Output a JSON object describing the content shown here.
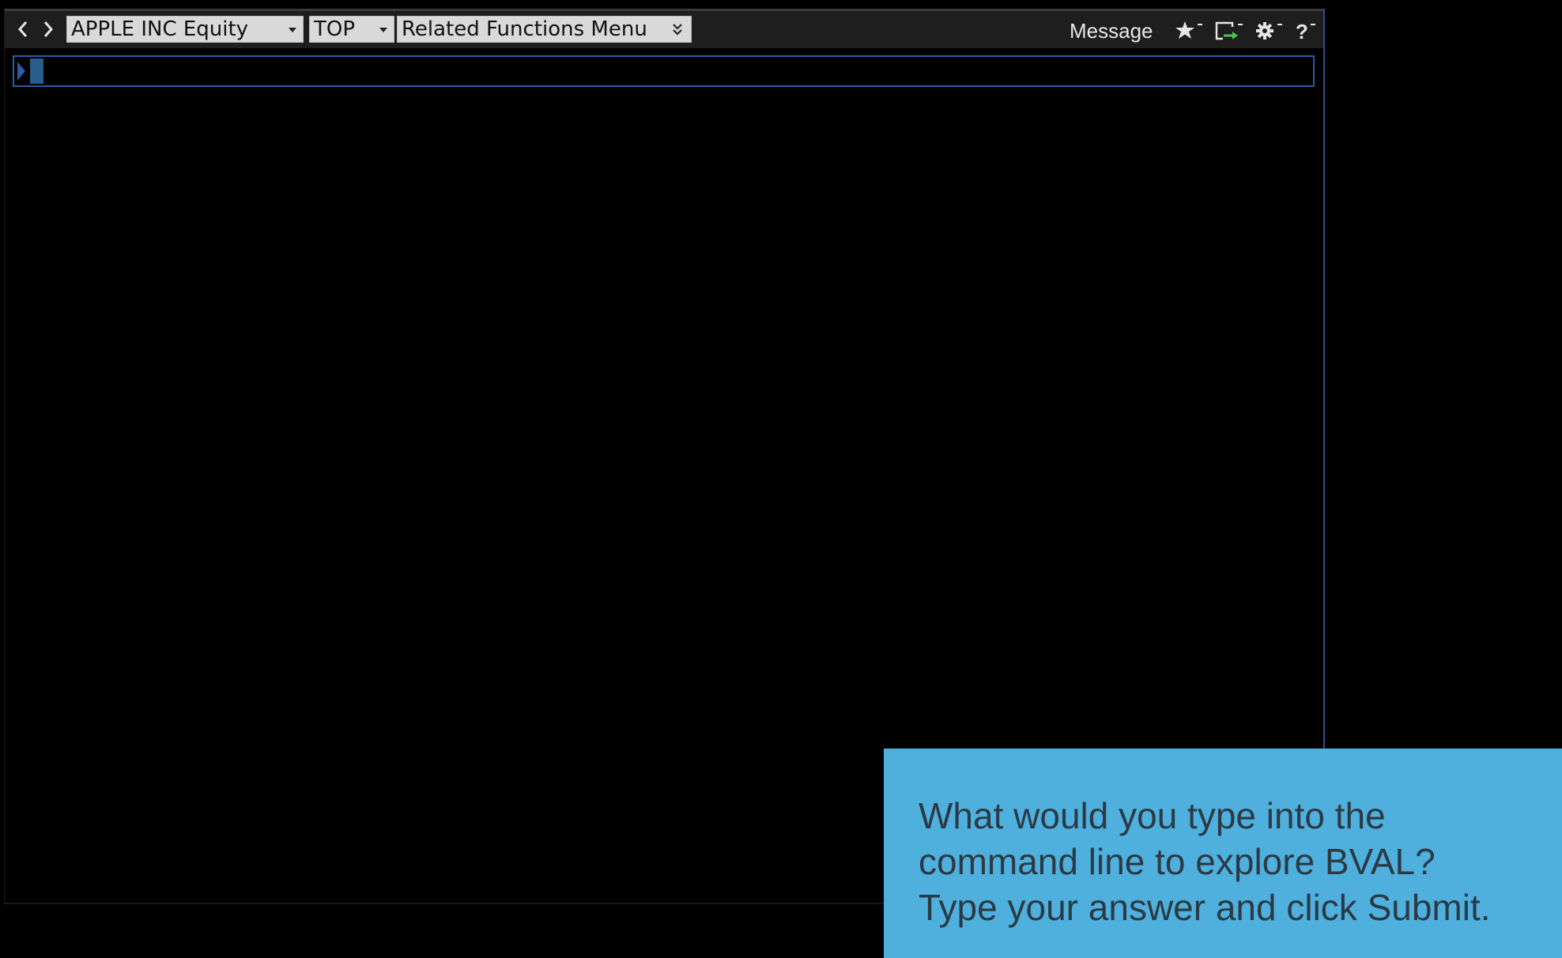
{
  "toolbar": {
    "security_label": "APPLE INC Equity",
    "menu_label": "TOP",
    "related_label": "Related Functions Menu",
    "message_label": "Message"
  },
  "icons": {
    "back": "chevron-left-icon",
    "forward": "chevron-right-icon",
    "favorites": "star-icon",
    "export": "export-icon",
    "settings": "gear-icon",
    "help": "help-icon"
  },
  "command_line": {
    "value": ""
  },
  "prompt": {
    "lines": [
      "What would you type into the",
      "command line to explore BVAL?",
      "Type your answer and click Submit."
    ]
  },
  "colors": {
    "background": "#000000",
    "toolbar": "#1e1e1e",
    "dropdown": "#d9d9d9",
    "command_border": "#2e5aa8",
    "prompt_background": "#4fb0de",
    "prompt_text": "#2b3a44"
  }
}
